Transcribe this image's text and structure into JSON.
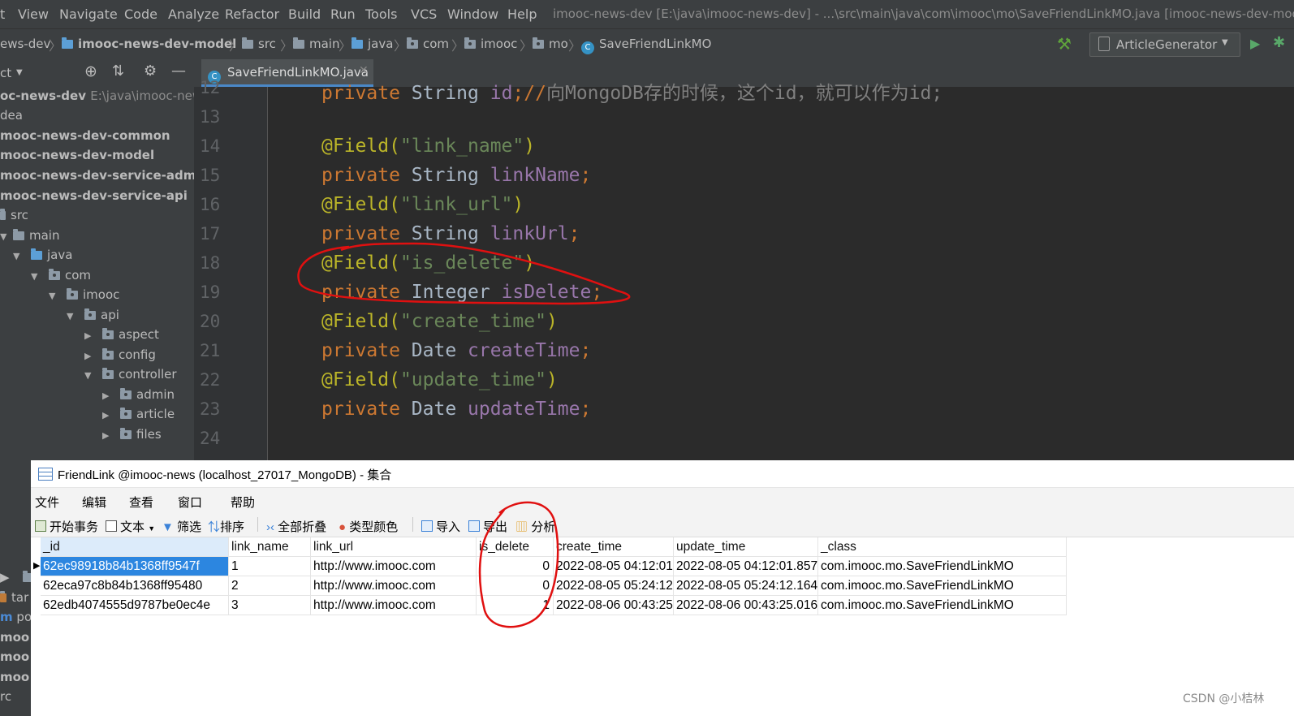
{
  "menubar": {
    "items": [
      "t",
      "View",
      "Navigate",
      "Code",
      "Analyze",
      "Refactor",
      "Build",
      "Run",
      "Tools",
      "VCS",
      "Window",
      "Help"
    ],
    "window_title": "imooc-news-dev [E:\\java\\imooc-news-dev] - ...\\src\\main\\java\\com\\imooc\\mo\\SaveFriendLinkMO.java [imooc-news-dev-model]"
  },
  "navbar": {
    "crumbs": [
      "ews-dev",
      "imooc-news-dev-model",
      "src",
      "main",
      "java",
      "com",
      "imooc",
      "mo",
      "SaveFriendLinkMO"
    ],
    "run_config": "ArticleGenerator"
  },
  "project": {
    "header": "ct",
    "tree": [
      {
        "label": "oc-news-dev",
        "extra": "E:\\java\\imooc-news-dev",
        "bold": true
      },
      {
        "label": "dea",
        "bold": false
      },
      {
        "label": "mooc-news-dev-common",
        "bold": true
      },
      {
        "label": "mooc-news-dev-model",
        "bold": true
      },
      {
        "label": "mooc-news-dev-service-admin",
        "bold": true
      },
      {
        "label": "mooc-news-dev-service-api",
        "bold": true
      },
      {
        "label": "src",
        "bold": false
      },
      {
        "label": "main",
        "bold": false
      },
      {
        "label": "java",
        "bold": false
      },
      {
        "label": "com",
        "bold": false
      },
      {
        "label": "imooc",
        "bold": false
      },
      {
        "label": "api",
        "bold": false
      },
      {
        "label": "aspect",
        "bold": false
      },
      {
        "label": "config",
        "bold": false
      },
      {
        "label": "controller",
        "bold": false
      },
      {
        "label": "admin",
        "bold": false
      },
      {
        "label": "article",
        "bold": false
      },
      {
        "label": "files",
        "bold": false
      }
    ],
    "bottom": [
      "tar",
      "po",
      "moo",
      "moo",
      "moo",
      "rc"
    ]
  },
  "editor": {
    "tab": "SaveFriendLinkMO.java",
    "line_numbers": [
      "12",
      "13",
      "14",
      "15",
      "16",
      "17",
      "18",
      "19",
      "20",
      "21",
      "22",
      "23",
      "24"
    ],
    "l12": {
      "kw": "private",
      "typ": " String ",
      "fld": "id",
      "rest": ";//",
      "cmt": "向MongoDB存的时候，这个id，就可以作为id;"
    },
    "l14": {
      "ann": "@Field(",
      "str": "\"link_name\"",
      "ann2": ")"
    },
    "l15": {
      "kw": "private",
      "typ": " String ",
      "fld": "linkName",
      "end": ";"
    },
    "l16": {
      "ann": "@Field(",
      "str": "\"link_url\"",
      "ann2": ")"
    },
    "l17": {
      "kw": "private",
      "typ": " String ",
      "fld": "linkUrl",
      "end": ";"
    },
    "l18": {
      "ann": "@Field(",
      "str": "\"is_delete\"",
      "ann2": ")"
    },
    "l19": {
      "kw": "private",
      "typ": " Integer ",
      "fld": "isDelete",
      "end": ";"
    },
    "l20": {
      "ann": "@Field(",
      "str": "\"create_time\"",
      "ann2": ")"
    },
    "l21": {
      "kw": "private",
      "typ": " Date ",
      "fld": "createTime",
      "end": ";"
    },
    "l22": {
      "ann": "@Field(",
      "str": "\"update_time\"",
      "ann2": ")"
    },
    "l23": {
      "kw": "private",
      "typ": " Date ",
      "fld": "updateTime",
      "end": ";"
    }
  },
  "mongo": {
    "title": "FriendLink @imooc-news (localhost_27017_MongoDB) - 集合",
    "menu": [
      "文件",
      "编辑",
      "查看",
      "窗口",
      "帮助"
    ],
    "toolbar": [
      "开始事务",
      "文本",
      "筛选",
      "排序",
      "全部折叠",
      "类型颜色",
      "导入",
      "导出",
      "分析"
    ],
    "columns": [
      "_id",
      "link_name",
      "link_url",
      "is_delete",
      "create_time",
      "update_time",
      "_class"
    ],
    "rows": [
      [
        "62ec98918b84b1368ff9547f",
        "1",
        "http://www.imooc.com",
        "0",
        "2022-08-05 04:12:01",
        "2022-08-05 04:12:01.857",
        "com.imooc.mo.SaveFriendLinkMO"
      ],
      [
        "62eca97c8b84b1368ff95480",
        "2",
        "http://www.imooc.com",
        "0",
        "2022-08-05 05:24:12",
        "2022-08-05 05:24:12.164",
        "com.imooc.mo.SaveFriendLinkMO"
      ],
      [
        "62edb4074555d9787be0ec4e",
        "3",
        "http://www.imooc.com",
        "1",
        "2022-08-06 00:43:25",
        "2022-08-06 00:43:25.016",
        "com.imooc.mo.SaveFriendLinkMO"
      ]
    ]
  },
  "watermark": "CSDN @小桔林",
  "colors": {
    "keyword": "#cc7832",
    "annotation": "#bbb529",
    "string": "#6a8759",
    "field": "#9876aa",
    "selection": "#2c86e0",
    "annotation_circle": "#e01010"
  }
}
